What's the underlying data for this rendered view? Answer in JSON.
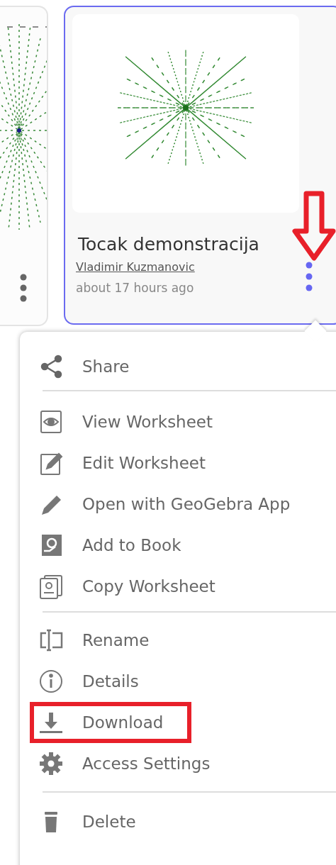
{
  "card": {
    "title": "Tocak demonstracija",
    "author": "Vladimir Kuzmanovic",
    "time": "about 17 hours ago",
    "selected": true
  },
  "menu": {
    "groups": [
      [
        {
          "label": "Share",
          "kind": "share",
          "highlighted": false
        }
      ],
      [
        {
          "label": "View Worksheet",
          "kind": "view",
          "highlighted": false
        },
        {
          "label": "Edit Worksheet",
          "kind": "edit",
          "highlighted": false
        },
        {
          "label": "Open with GeoGebra App",
          "kind": "open",
          "highlighted": false
        },
        {
          "label": "Add to Book",
          "kind": "add",
          "highlighted": false
        },
        {
          "label": "Copy Worksheet",
          "kind": "copy",
          "highlighted": false
        }
      ],
      [
        {
          "label": "Rename",
          "kind": "rename",
          "highlighted": false
        },
        {
          "label": "Details",
          "kind": "details",
          "highlighted": false
        },
        {
          "label": "Download",
          "kind": "download",
          "highlighted": true
        },
        {
          "label": "Access Settings",
          "kind": "access",
          "highlighted": false
        }
      ],
      [
        {
          "label": "Delete",
          "kind": "delete",
          "highlighted": false
        }
      ]
    ]
  }
}
